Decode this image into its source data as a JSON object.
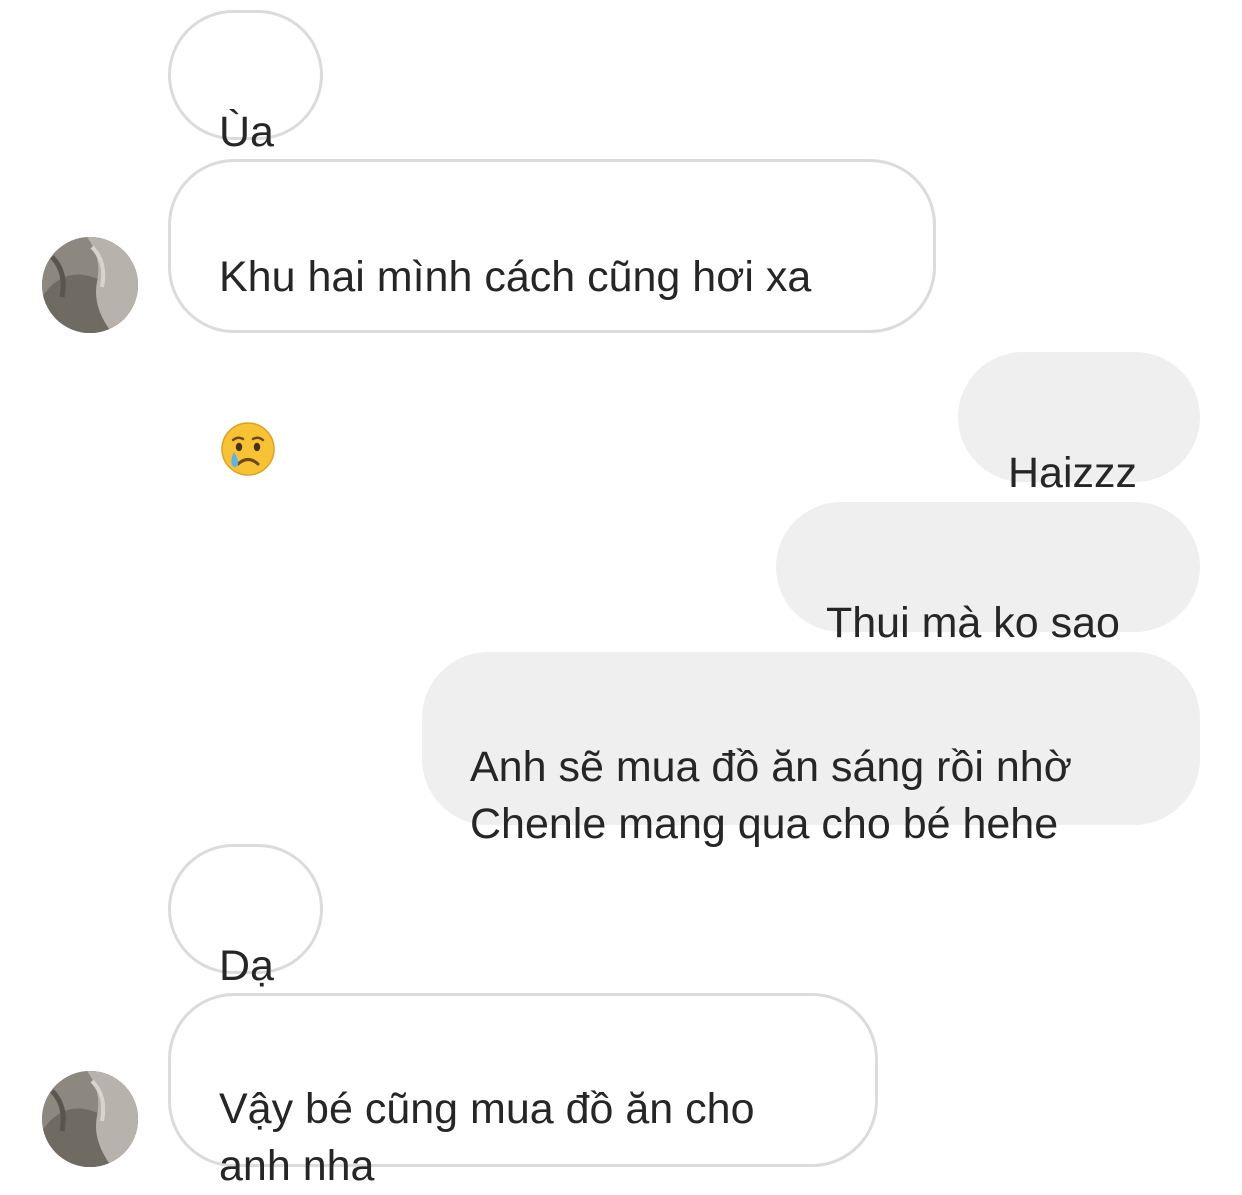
{
  "conversation": {
    "messages": [
      {
        "sender": "other",
        "text": "Ùa"
      },
      {
        "sender": "other",
        "text": "Khu hai mình cách cũng hơi xa",
        "emoji": "crying-face"
      },
      {
        "sender": "me",
        "text": "Haizzz"
      },
      {
        "sender": "me",
        "text": "Thui mà ko sao"
      },
      {
        "sender": "me",
        "text": "Anh sẽ mua đồ ăn sáng rồi nhờ\nChenle mang qua cho bé hehe"
      },
      {
        "sender": "other",
        "text": "Dạ"
      },
      {
        "sender": "other",
        "text": "Vậy bé cũng mua đồ ăn cho\nanh nha"
      }
    ]
  },
  "colors": {
    "incoming_bubble_bg": "#ffffff",
    "incoming_bubble_border": "#dbdbdb",
    "outgoing_bubble_bg": "#efefef",
    "text": "#262626"
  }
}
